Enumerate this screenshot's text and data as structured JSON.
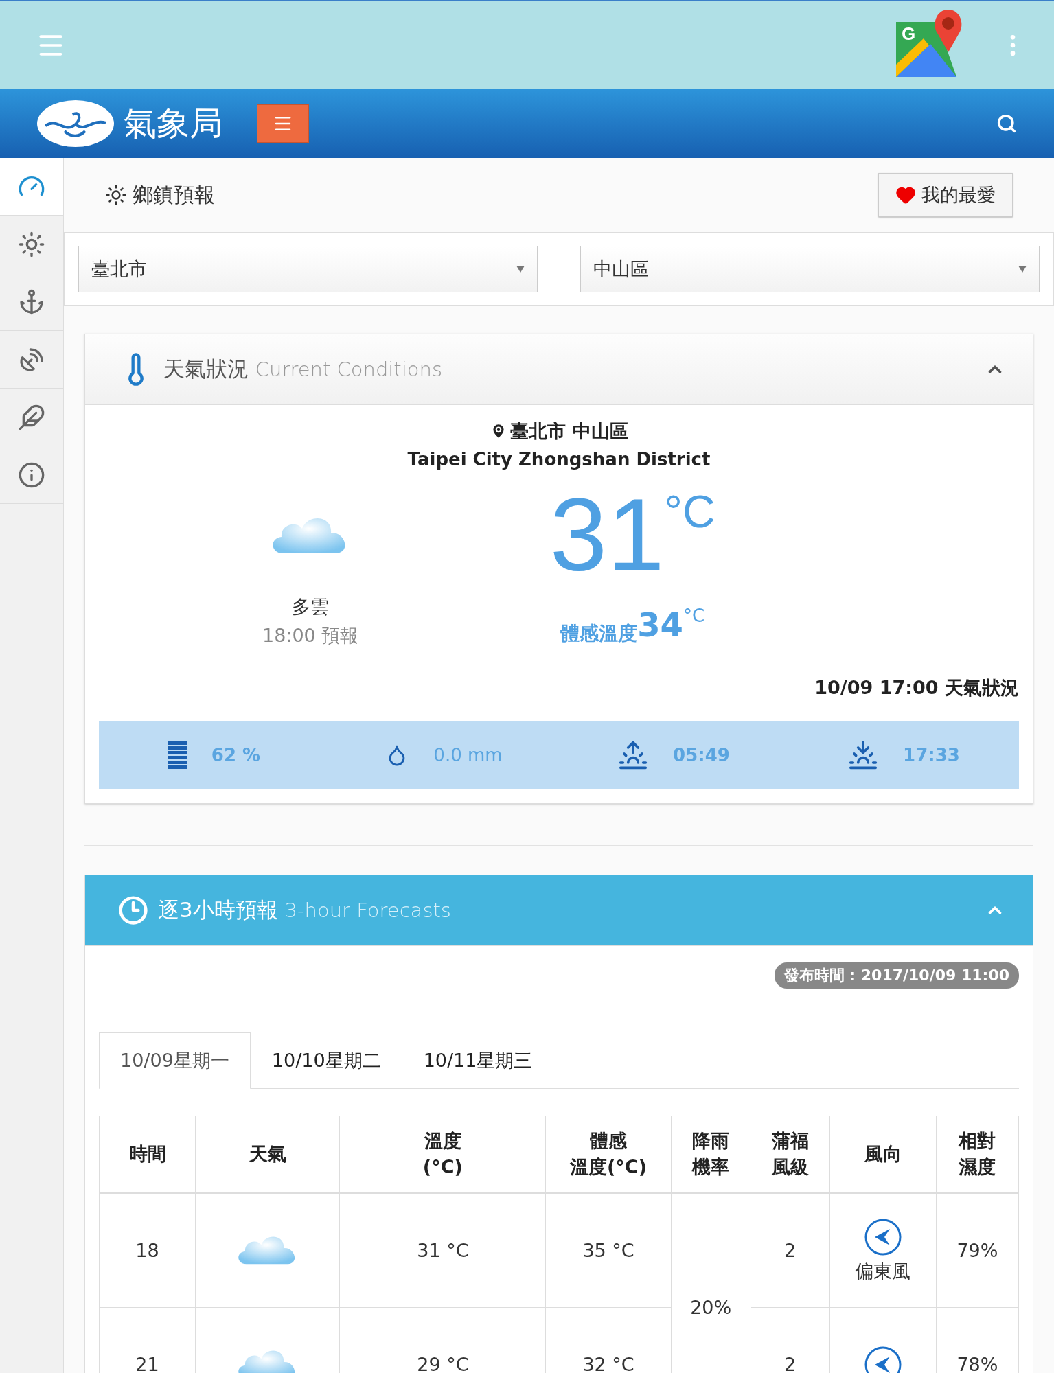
{
  "top_bar": {
    "app_icon_letter": "G"
  },
  "header": {
    "logo_text": "氣象局"
  },
  "sidebar": {
    "items": [
      {
        "kind": "gauge",
        "selected": true
      },
      {
        "kind": "sun",
        "selected": false
      },
      {
        "kind": "anchor",
        "selected": false
      },
      {
        "kind": "dish",
        "selected": false
      },
      {
        "kind": "feather",
        "selected": false
      },
      {
        "kind": "info",
        "selected": false
      }
    ]
  },
  "page_title": "鄉鎮預報",
  "favorite_button": "我的最愛",
  "selects": [
    {
      "value": "臺北市"
    },
    {
      "value": "中山區"
    }
  ],
  "current": {
    "title": "天氣狀況",
    "subtitle": "Current Conditions",
    "expanded": true,
    "location": "臺北市 中山區",
    "location_en": "Taipei City Zhongshan District",
    "weather": "多雲",
    "forecast_time": "18:00 預報",
    "temperature": "31",
    "unit": "°C",
    "feels_label": "體感溫度",
    "feels_value": "34",
    "feels_unit": "°C",
    "observed": "10/09 17:00 天氣狀況",
    "stats": [
      {
        "kind": "humidity",
        "value": "62 %"
      },
      {
        "kind": "rain",
        "value": "0.0 mm"
      },
      {
        "kind": "sunrise",
        "value": "05:49"
      },
      {
        "kind": "sunset",
        "value": "17:33"
      }
    ]
  },
  "forecast": {
    "title": "逐3小時預報",
    "subtitle": "3-hour Forecasts",
    "expanded": true,
    "published": "發布時間 : 2017/10/09 11:00",
    "tabs": [
      {
        "label": "10/09星期一",
        "selected": true
      },
      {
        "label": "10/10星期二",
        "selected": false
      },
      {
        "label": "10/11星期三",
        "selected": false
      }
    ],
    "columns": [
      {
        "lines": [
          "時間"
        ]
      },
      {
        "lines": [
          "天氣"
        ]
      },
      {
        "lines": [
          "溫度",
          "(°C)"
        ]
      },
      {
        "lines": [
          "體感",
          "溫度(°C)"
        ]
      },
      {
        "lines": [
          "降雨",
          "機率"
        ]
      },
      {
        "lines": [
          "蒲福",
          "風級"
        ]
      },
      {
        "lines": [
          "風向"
        ]
      },
      {
        "lines": [
          "相對",
          "濕度"
        ]
      }
    ],
    "rows": [
      {
        "time": "18",
        "temp": "31 °C",
        "feels": "35 °C",
        "rain": "20%",
        "beaufort": "2",
        "wind": "偏東風",
        "humidity": "79%"
      },
      {
        "time": "21",
        "temp": "29 °C",
        "feels": "32 °C",
        "beaufort": "2",
        "humidity": "78%"
      }
    ]
  }
}
